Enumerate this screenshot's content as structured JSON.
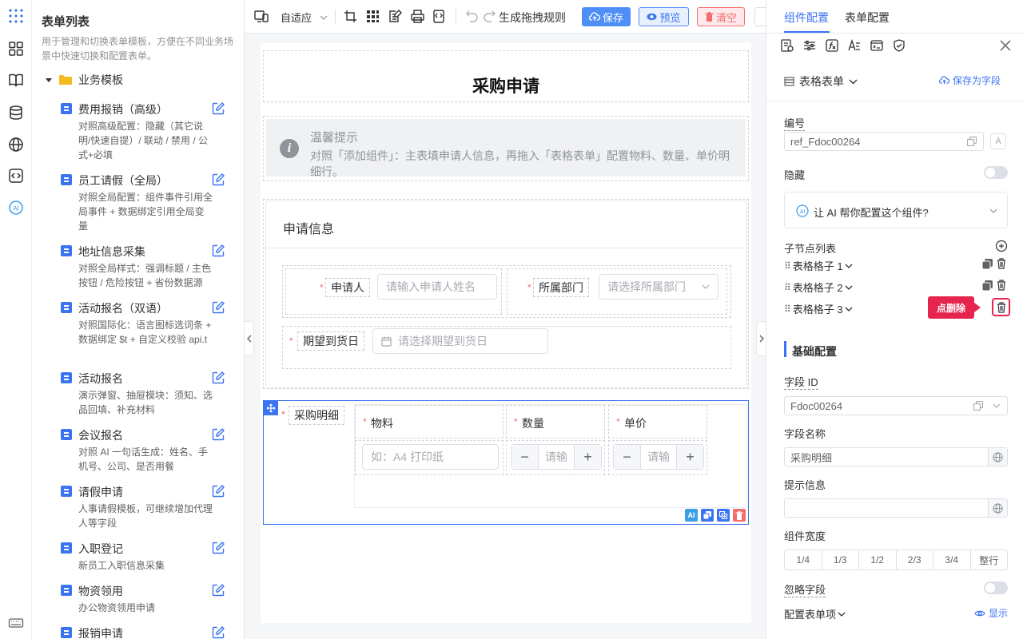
{
  "left_panel": {
    "title": "表单列表",
    "desc": "用于管理和切换表单模板，方便在不同业务场景中快速切换和配置表单。",
    "group": "业务模板",
    "templates": [
      {
        "name": "费用报销（高级）",
        "desc": "对照高级配置：隐藏（其它说明/快速自提）/ 联动 / 禁用 / 公式+必填"
      },
      {
        "name": "员工请假（全局）",
        "desc": "对照全局配置：组件事件引用全局事件 + 数据绑定引用全局变量"
      },
      {
        "name": "地址信息采集",
        "desc": "对照全局样式：强调标题 / 主色按钮 / 危险按钮 + 省份数据源"
      },
      {
        "name": "活动报名（双语）",
        "desc": "对照国际化：语言图标选词条 + 数据绑定 $t + 自定义校验 api.t"
      },
      {
        "name": "活动报名",
        "desc": "演示弹窗、抽屉模块：须知、选品回填、补充材料"
      },
      {
        "name": "会议报名",
        "desc": "对照 AI 一句话生成：姓名、手机号、公司、是否用餐"
      },
      {
        "name": "请假申请",
        "desc": "人事请假模板，可继续增加代理人等字段"
      },
      {
        "name": "入职登记",
        "desc": "新员工入职信息采集"
      },
      {
        "name": "物资领用",
        "desc": "办公物资领用申请"
      },
      {
        "name": "报销申请",
        "desc": ""
      }
    ]
  },
  "toolbar": {
    "adaptive": "自适应",
    "gen_rule": "生成拖拽规则",
    "save": "保存",
    "preview": "预览",
    "clear": "清空"
  },
  "form": {
    "title": "采购申请",
    "notice_title": "温馨提示",
    "notice_text": "对照「添加组件」：主表填申请人信息，再拖入「表格表单」配置物料、数量、单价明细行。",
    "section_title": "申请信息",
    "applicant_label": "申请人",
    "applicant_placeholder": "请输入申请人姓名",
    "dept_label": "所属部门",
    "dept_placeholder": "请选择所属部门",
    "date_label": "期望到货日",
    "date_placeholder": "请选择期望到货日",
    "detail_label": "采购明细",
    "col_material": "物料",
    "col_qty": "数量",
    "col_price": "单价",
    "material_placeholder": "如：A4 打印纸",
    "qty_placeholder": "请输",
    "price_placeholder": "请输",
    "req_mark": "*"
  },
  "right_panel": {
    "tab_component": "组件配置",
    "tab_form": "表单配置",
    "component_type": "表格表单",
    "save_as_field": "保存为字段",
    "id_label": "编号",
    "id_value": "ref_Fdoc00264",
    "hidden_label": "隐藏",
    "ai_prompt": "让 AI 帮你配置这个组件?",
    "children_label": "子节点列表",
    "children": [
      "表格格子 1",
      "表格格子 2",
      "表格格子 3"
    ],
    "delete_tooltip": "点删除",
    "basic_config": "基础配置",
    "field_id_label": "字段 ID",
    "field_id_value": "Fdoc00264",
    "field_name_label": "字段名称",
    "field_name_value": "采购明细",
    "hint_label": "提示信息",
    "width_label": "组件宽度",
    "widths": [
      "1/4",
      "1/3",
      "1/2",
      "2/3",
      "3/4",
      "整行"
    ],
    "ignore_label": "忽略字段",
    "config_items_label": "配置表单项",
    "show_label": "显示"
  },
  "colors": {
    "primary": "#3b74f2",
    "danger": "#f56c6c",
    "tooltip": "#e5254d"
  }
}
